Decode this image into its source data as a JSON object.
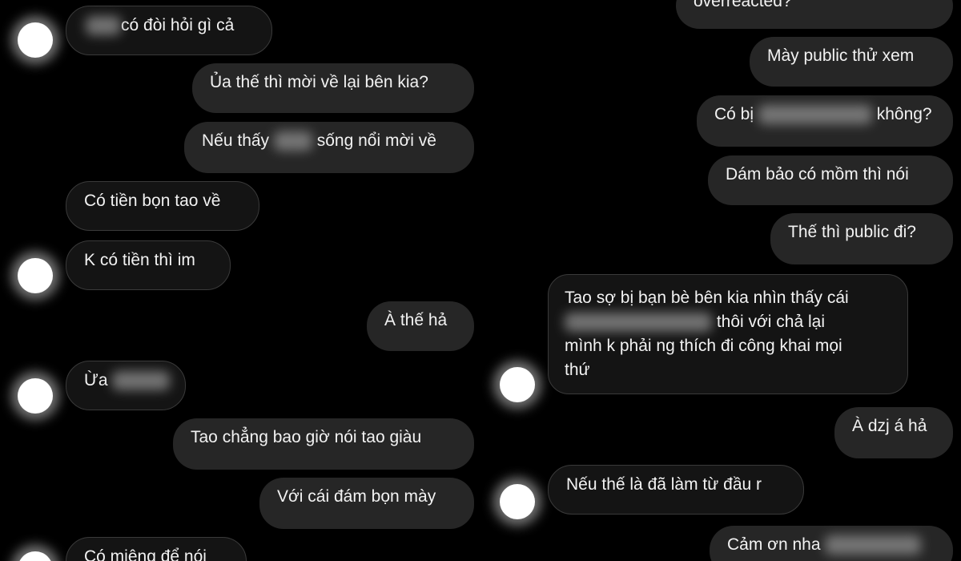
{
  "left": {
    "m1": {
      "text": "có đòi hỏi gì cả"
    },
    "m2": {
      "text": "Ủa thế thì mời về lại bên kia?"
    },
    "m3": {
      "before": "Nếu thấy",
      "after": "sống nổi mời về"
    },
    "m4": {
      "text": "Có tiền bọn tao về"
    },
    "m5": {
      "text": "K có tiền thì im"
    },
    "m6": {
      "text": "À thế hả"
    },
    "m7": {
      "text": "Ừa"
    },
    "m8": {
      "text": "Tao chẳng bao giờ nói tao giàu"
    },
    "m9": {
      "text": "Với cái đám bọn mày"
    },
    "m10": {
      "text": "Có miệng để nói"
    }
  },
  "right": {
    "r1": {
      "text": "overreacted?"
    },
    "r2": {
      "text": "Mày public thử xem"
    },
    "r3": {
      "before": "Có bị",
      "after": "không?"
    },
    "r4": {
      "text": "Dám bảo có mồm thì nói"
    },
    "r5": {
      "text": "Thế thì public đi?"
    },
    "r6": {
      "line1": "Tao sợ bị bạn bè bên kia nhìn thấy cái",
      "line2": "thôi với chả lại",
      "line3": "mình k phải ng thích đi công khai mọi",
      "line4": "thứ"
    },
    "r7": {
      "text": "À dzj á hả"
    },
    "r8": {
      "text": "Nếu thế là đã làm từ đầu r"
    },
    "r9": {
      "text": "Cảm ơn nha"
    }
  }
}
